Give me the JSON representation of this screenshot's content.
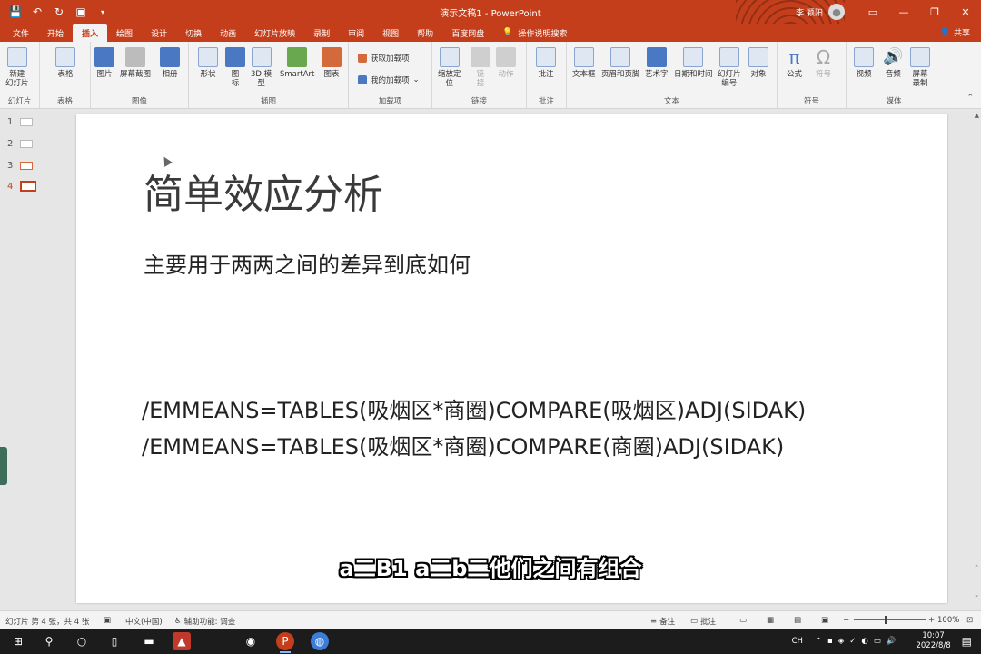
{
  "window": {
    "title": "演示文稿1 - PowerPoint",
    "user": "李 颖阳",
    "share": "共享"
  },
  "tabs": [
    "文件",
    "开始",
    "插入",
    "绘图",
    "设计",
    "切换",
    "动画",
    "幻灯片放映",
    "录制",
    "审阅",
    "视图",
    "帮助",
    "百度网盘"
  ],
  "active_tab": "插入",
  "tell_me": "操作说明搜索",
  "ribbon": {
    "slides": {
      "new_slide": "新建\n幻灯片",
      "label": "幻灯片"
    },
    "tables": {
      "table": "表格",
      "label": "表格"
    },
    "images": {
      "picture": "图片",
      "screenshot": "屏幕截图",
      "album": "相册",
      "label": "图像"
    },
    "illustrations": {
      "shapes": "形状",
      "icons": "图\n标",
      "3d": "3D 模\n型",
      "smartart": "SmartArt",
      "chart": "图表",
      "label": "插图"
    },
    "addins": {
      "get": "获取加载项",
      "mine": "我的加载项",
      "label": "加载项"
    },
    "links": {
      "zoom": "缩放定\n位",
      "link": "链\n接",
      "action": "动作",
      "label": "链接"
    },
    "comments": {
      "comment": "批注",
      "label": "批注"
    },
    "text": {
      "textbox": "文本框",
      "header": "页眉和页脚",
      "wordart": "艺术字",
      "datetime": "日期和时间",
      "slidenum": "幻灯片\n编号",
      "object": "对象",
      "label": "文本"
    },
    "symbols": {
      "equation": "公式",
      "symbol": "符号",
      "label": "符号"
    },
    "media": {
      "video": "视频",
      "audio": "音频",
      "screenrec": "屏幕\n录制",
      "label": "媒体"
    }
  },
  "slides_panel": [
    {
      "num": "1"
    },
    {
      "num": "2"
    },
    {
      "num": "3"
    },
    {
      "num": "4"
    }
  ],
  "slide": {
    "title": "简单效应分析",
    "subtitle": "主要用于两两之间的差异到底如何",
    "line1": "/EMMEANS=TABLES(吸烟区*商圈)COMPARE(吸烟区)ADJ(SIDAK)",
    "line2": "/EMMEANS=TABLES(吸烟区*商圈)COMPARE(商圈)ADJ(SIDAK)"
  },
  "caption": "a二B1  a二b二他们之间有组合",
  "status": {
    "slide_info": "幻灯片 第 4 张，共 4 张",
    "language": "中文(中国)",
    "accessibility": "辅助功能: 调查",
    "notes": "备注",
    "comments": "批注",
    "zoom": "100%"
  },
  "taskbar": {
    "time": "10:07",
    "date": "2022/8/8",
    "ime": "CH"
  }
}
